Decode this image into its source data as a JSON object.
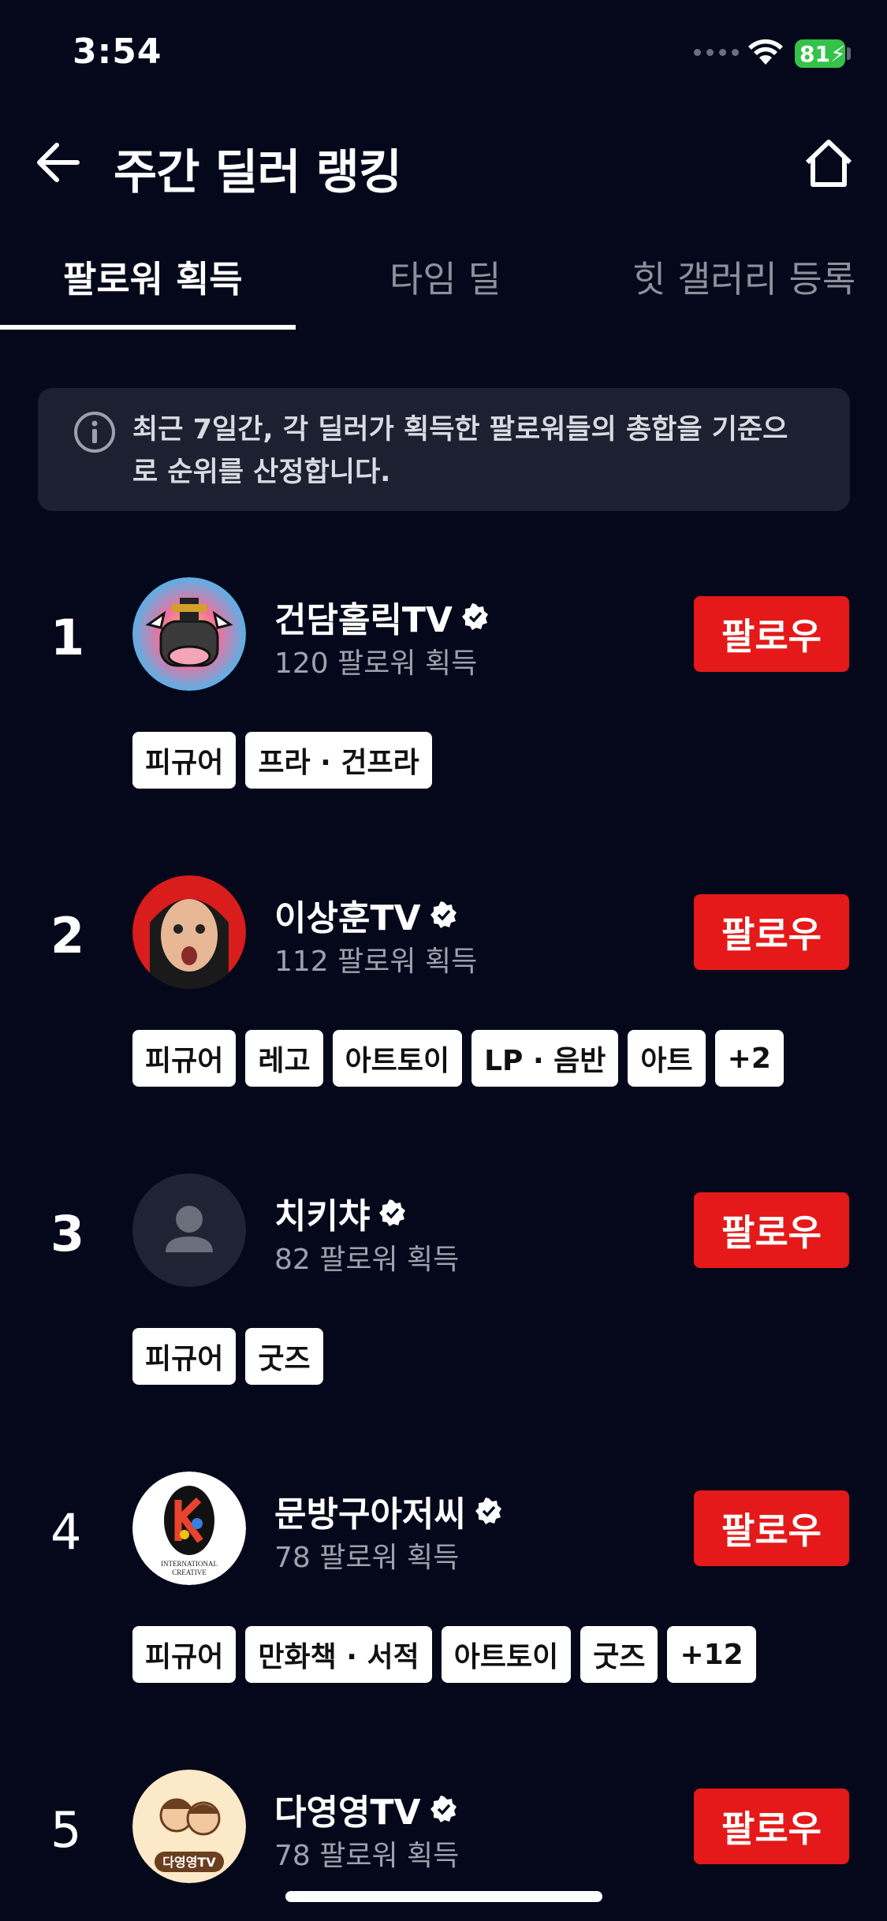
{
  "status_bar": {
    "time": "3:54",
    "battery": "81"
  },
  "header": {
    "title": "주간 딜러 랭킹"
  },
  "tabs": [
    {
      "label": "팔로워 획득",
      "active": true
    },
    {
      "label": "타임 딜",
      "active": false
    },
    {
      "label": "힛 갤러리 등록",
      "active": false
    }
  ],
  "info": {
    "text": "최근 7일간, 각 딜러가 획득한 팔로워들의 총합을 기준으로 순위를 산정합니다."
  },
  "follow_label": "팔로우",
  "rankings": [
    {
      "rank": "1",
      "name": "건담홀릭TV",
      "followers": "120 팔로워 획득",
      "tags": [
        "피규어",
        "프라 · 건프라"
      ]
    },
    {
      "rank": "2",
      "name": "이상훈TV",
      "followers": "112 팔로워 획득",
      "tags": [
        "피규어",
        "레고",
        "아트토이",
        "LP · 음반",
        "아트",
        "+2"
      ]
    },
    {
      "rank": "3",
      "name": "치키챠",
      "followers": "82 팔로워 획득",
      "tags": [
        "피규어",
        "굿즈"
      ]
    },
    {
      "rank": "4",
      "name": "문방구아저씨",
      "followers": "78 팔로워 획득",
      "tags": [
        "피규어",
        "만화책 · 서적",
        "아트토이",
        "굿즈",
        "+12"
      ]
    },
    {
      "rank": "5",
      "name": "다영영TV",
      "followers": "78 팔로워 획득",
      "tags": []
    }
  ],
  "avatar4_text": "INTERNATIONAL CREATIVE",
  "avatar5_text": "다영영TV",
  "colors": {
    "background": "#05081a",
    "accent": "#e51919",
    "info_bg": "#1c2030",
    "battery": "#35c24a"
  }
}
